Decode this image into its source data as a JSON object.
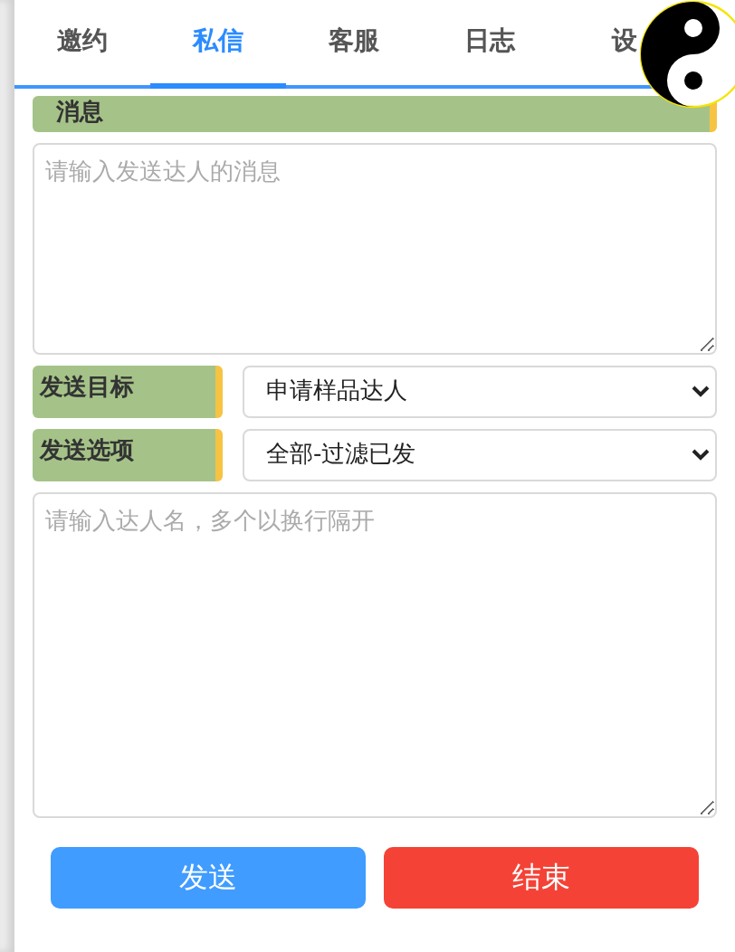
{
  "tabs": [
    {
      "label": "邀约",
      "selected": false
    },
    {
      "label": "私信",
      "selected": true
    },
    {
      "label": "客服",
      "selected": false
    },
    {
      "label": "日志",
      "selected": false
    },
    {
      "label": "设",
      "selected": false
    }
  ],
  "message": {
    "header": "消息",
    "placeholder": "请输入发送达人的消息"
  },
  "options": [
    {
      "label": "发送目标",
      "value": "申请样品达人"
    },
    {
      "label": "发送选项",
      "value": "全部-过滤已发"
    }
  ],
  "names": {
    "placeholder": "请输入达人名，多个以换行隔开"
  },
  "buttons": [
    {
      "label": "发送",
      "kind": "primary"
    },
    {
      "label": "结束",
      "kind": "danger"
    }
  ]
}
